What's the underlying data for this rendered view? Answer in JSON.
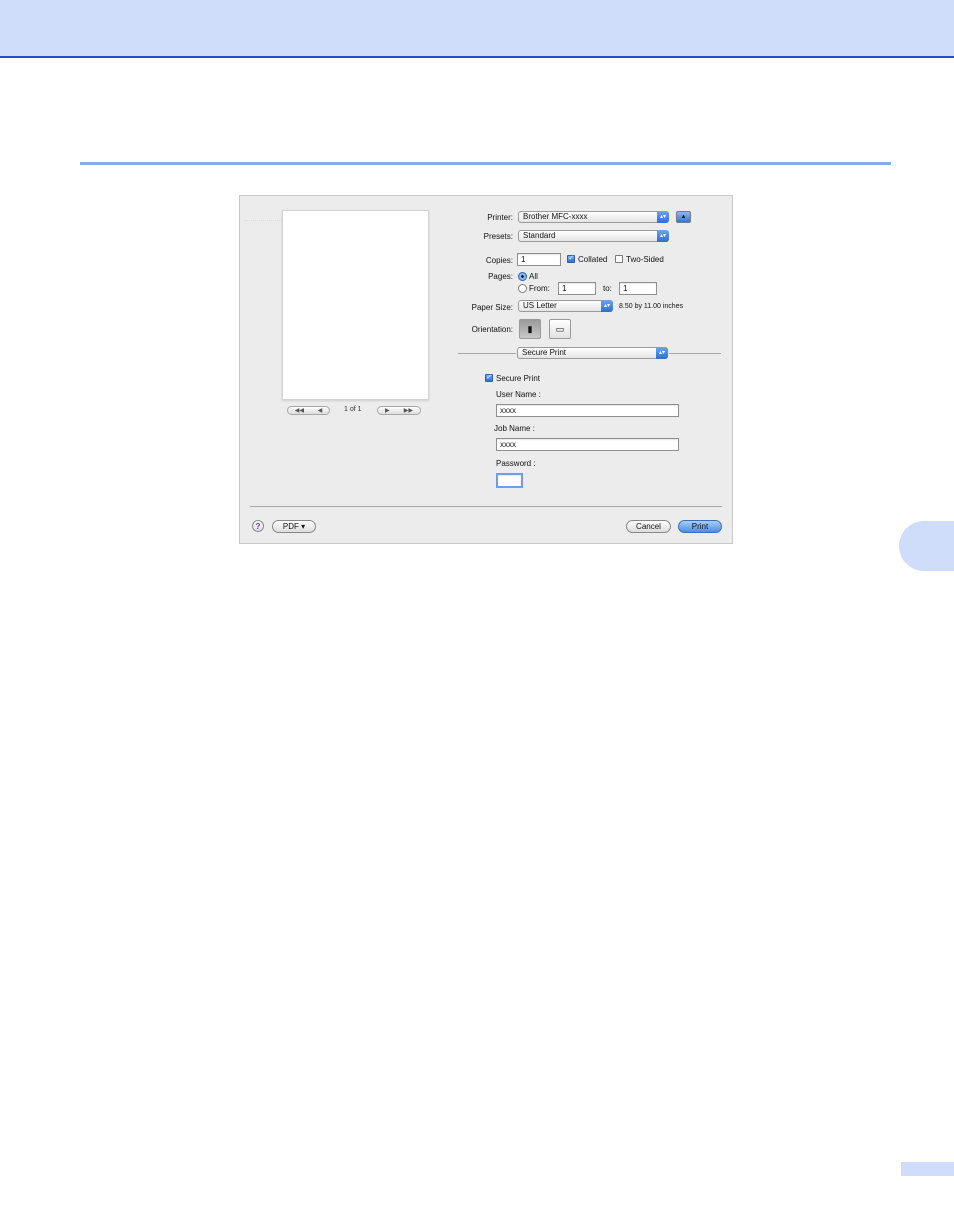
{
  "dialog": {
    "printer": {
      "label": "Printer:",
      "value": "Brother MFC-xxxx"
    },
    "presets": {
      "label": "Presets:",
      "value": "Standard"
    },
    "copies": {
      "label": "Copies:",
      "value": "1",
      "collated_label": "Collated",
      "collated_checked": true,
      "two_sided_label": "Two-Sided",
      "two_sided_checked": false
    },
    "pages": {
      "label": "Pages:",
      "all_label": "All",
      "from_label": "From:",
      "from_value": "1",
      "to_label": "to:",
      "to_value": "1",
      "selected": "All"
    },
    "paper_size": {
      "label": "Paper Size:",
      "value": "US Letter",
      "dimensions": "8.50 by 11.00 inches"
    },
    "orientation": {
      "label": "Orientation:",
      "portrait_icon": "portrait-orientation-icon",
      "landscape_icon": "landscape-orientation-icon",
      "selected": "portrait"
    },
    "panel_select": {
      "value": "Secure Print"
    },
    "secure_print": {
      "checkbox_label": "Secure Print",
      "checked": true,
      "user_name_label": "User Name :",
      "user_name_value": "xxxx",
      "job_name_label": "Job Name :",
      "job_name_value": "xxxx",
      "password_label": "Password :",
      "password_value": ""
    },
    "preview": {
      "page_count": "1 of 1",
      "first_icon": "first-page-icon",
      "prev_icon": "previous-page-icon",
      "next_icon": "next-page-icon",
      "last_icon": "last-page-icon"
    },
    "footer": {
      "help_icon": "help-icon",
      "help_glyph": "?",
      "pdf_label": "PDF ▾",
      "cancel_label": "Cancel",
      "print_label": "Print"
    }
  },
  "colors": {
    "page_header": "#cfdcfa",
    "page_header_border": "#1f4fc8",
    "accent_blue": "#2b6fd4"
  }
}
